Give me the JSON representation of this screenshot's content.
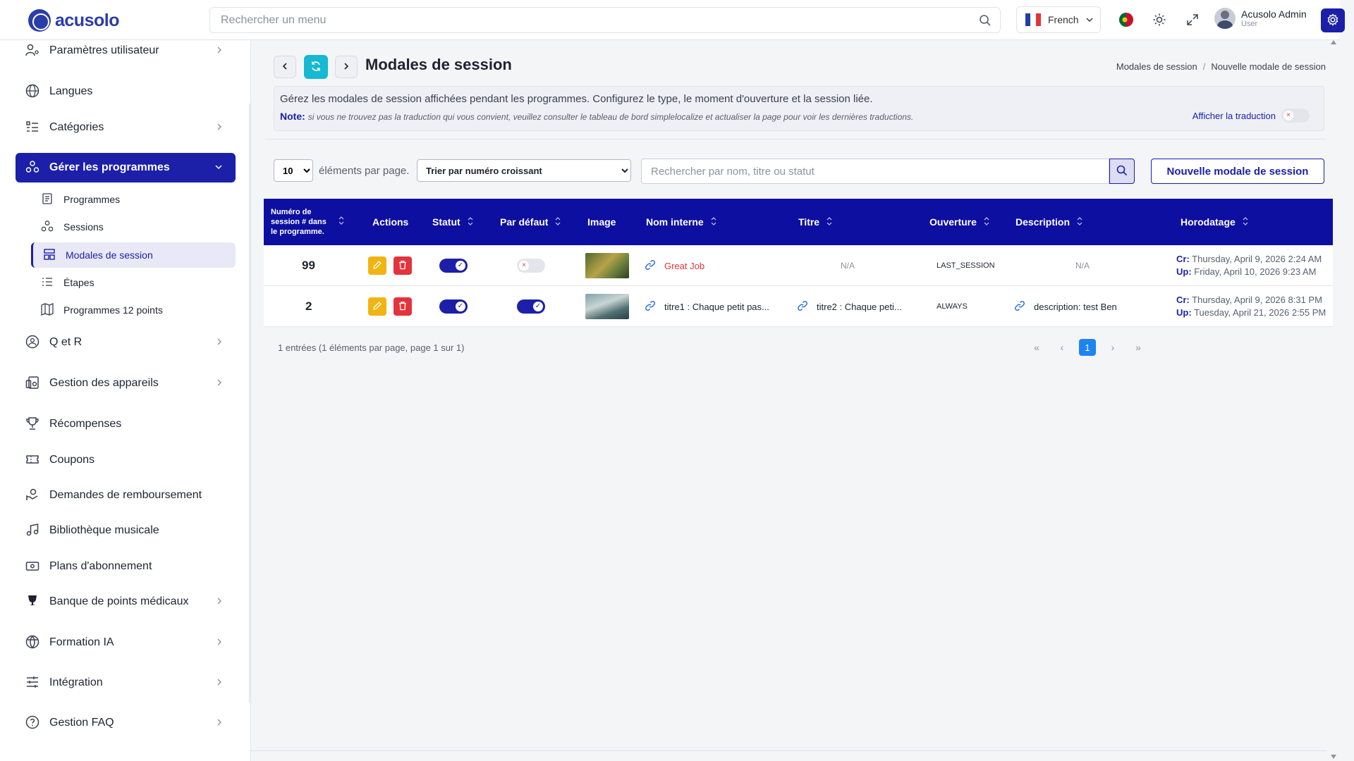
{
  "header": {
    "brand": "acusolo",
    "search_placeholder": "Rechercher un menu",
    "language": "French",
    "user_name": "Acusolo Admin",
    "user_role": "User",
    "flag_colors": [
      "#1f3fa3",
      "#ffffff",
      "#e5333c"
    ]
  },
  "sidebar": {
    "items": [
      {
        "label": "Paramètres utilisateur",
        "icon": "user-settings-icon",
        "chevron": true
      },
      {
        "label": "Langues",
        "icon": "globe-icon",
        "chevron": false
      },
      {
        "label": "Catégories",
        "icon": "category-list-icon",
        "chevron": true
      },
      {
        "label": "Gérer les programmes",
        "icon": "programs-icon",
        "chevron": true,
        "active": true
      },
      {
        "label": "Q et R",
        "icon": "qa-icon",
        "chevron": true
      },
      {
        "label": "Gestion des appareils",
        "icon": "devices-icon",
        "chevron": true
      },
      {
        "label": "Récompenses",
        "icon": "trophy-icon",
        "chevron": false
      },
      {
        "label": "Coupons",
        "icon": "coupon-icon",
        "chevron": false
      },
      {
        "label": "Demandes de remboursement",
        "icon": "refund-icon",
        "chevron": false
      },
      {
        "label": "Bibliothèque musicale",
        "icon": "music-icon",
        "chevron": false
      },
      {
        "label": "Plans d'abonnement",
        "icon": "subscription-icon",
        "chevron": false
      },
      {
        "label": "Banque de points médicaux",
        "icon": "award-icon",
        "chevron": true
      },
      {
        "label": "Formation IA",
        "icon": "ai-icon",
        "chevron": true
      },
      {
        "label": "Intégration",
        "icon": "sliders-icon",
        "chevron": true
      },
      {
        "label": "Gestion FAQ",
        "icon": "help-icon",
        "chevron": true
      }
    ],
    "subitems": [
      {
        "label": "Programmes",
        "icon": "program-icon"
      },
      {
        "label": "Sessions",
        "icon": "sessions-icon"
      },
      {
        "label": "Modales de session",
        "icon": "layout-icon",
        "active": true
      },
      {
        "label": "Étapes",
        "icon": "steps-icon"
      },
      {
        "label": "Programmes 12 points",
        "icon": "map-icon"
      }
    ]
  },
  "page": {
    "title": "Modales de session",
    "breadcrumb": [
      "Modales de session",
      "Nouvelle modale de session"
    ],
    "info_text": "Gérez les modales de session affichées pendant les programmes. Configurez le type, le moment d'ouverture et la session liée.",
    "note_label": "Note:",
    "note_text": "si vous ne trouvez pas la traduction qui vous convient, veuillez consulter le tableau de bord simplelocalize et actualiser la page pour voir les dernières traductions.",
    "translation_label": "Afficher la traduction",
    "per_page_value": "10",
    "per_page_label": "éléments par page.",
    "sort_value": "Trier par numéro croissant",
    "table_search_placeholder": "Rechercher par nom, titre ou statut",
    "new_button": "Nouvelle modale de session"
  },
  "table": {
    "columns": [
      "Numéro de session # dans le programme.",
      "Actions",
      "Statut",
      "Par défaut",
      "Image",
      "Nom interne",
      "Titre",
      "Ouverture",
      "Description",
      "Horodatage"
    ],
    "rows": [
      {
        "number": "99",
        "status_on": true,
        "default_on": false,
        "internal_name": "Great Job",
        "title": "N/A",
        "opening": "LAST_SESSION",
        "description": "N/A",
        "created_label": "Cr:",
        "created": "Thursday, April 9, 2026 2:24 AM",
        "updated_label": "Up:",
        "updated": "Friday, April 10, 2026 9:23 AM"
      },
      {
        "number": "2",
        "status_on": true,
        "default_on": true,
        "internal_name": "titre1 : Chaque petit pas...",
        "title": "titre2 : Chaque peti...",
        "opening": "ALWAYS",
        "description": "description: test Ben",
        "created_label": "Cr:",
        "created": "Thursday, April 9, 2026 8:31 PM",
        "updated_label": "Up:",
        "updated": "Tuesday, April 21, 2026 2:55 PM"
      }
    ]
  },
  "footer": {
    "entries_info": "1 entrées (1 éléments par page, page 1 sur 1)",
    "current_page": "1"
  },
  "colors": {
    "primary": "#1c1fa8",
    "table_header": "#0d0fa0",
    "accent_teal": "#17b8d1",
    "edit": "#f2b411",
    "delete": "#e5333c",
    "page_active": "#1e84f0"
  }
}
